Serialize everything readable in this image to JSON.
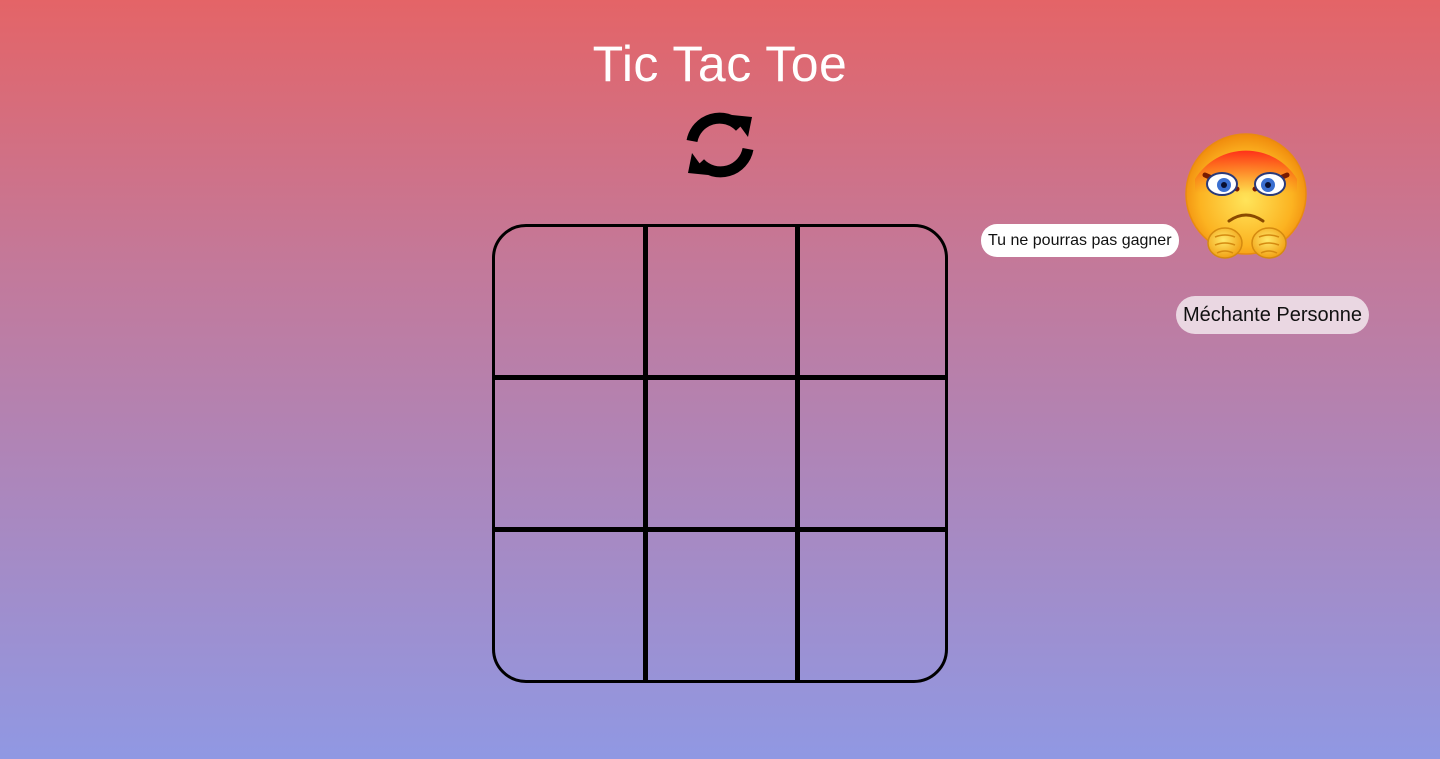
{
  "header": {
    "title": "Tic Tac Toe"
  },
  "controls": {
    "reset_icon": "refresh-icon"
  },
  "board": {
    "cells": [
      {
        "value": ""
      },
      {
        "value": ""
      },
      {
        "value": ""
      },
      {
        "value": ""
      },
      {
        "value": ""
      },
      {
        "value": ""
      },
      {
        "value": ""
      },
      {
        "value": ""
      },
      {
        "value": ""
      }
    ]
  },
  "opponent": {
    "taunt": "Tu ne pourras pas gagner",
    "name": "Méchante Personne",
    "avatar_icon": "angry-face-icon"
  },
  "colors": {
    "gradient_top": "#e46467",
    "gradient_bottom": "#9098e3",
    "grid_line": "#000000",
    "title_text": "#ffffff"
  }
}
